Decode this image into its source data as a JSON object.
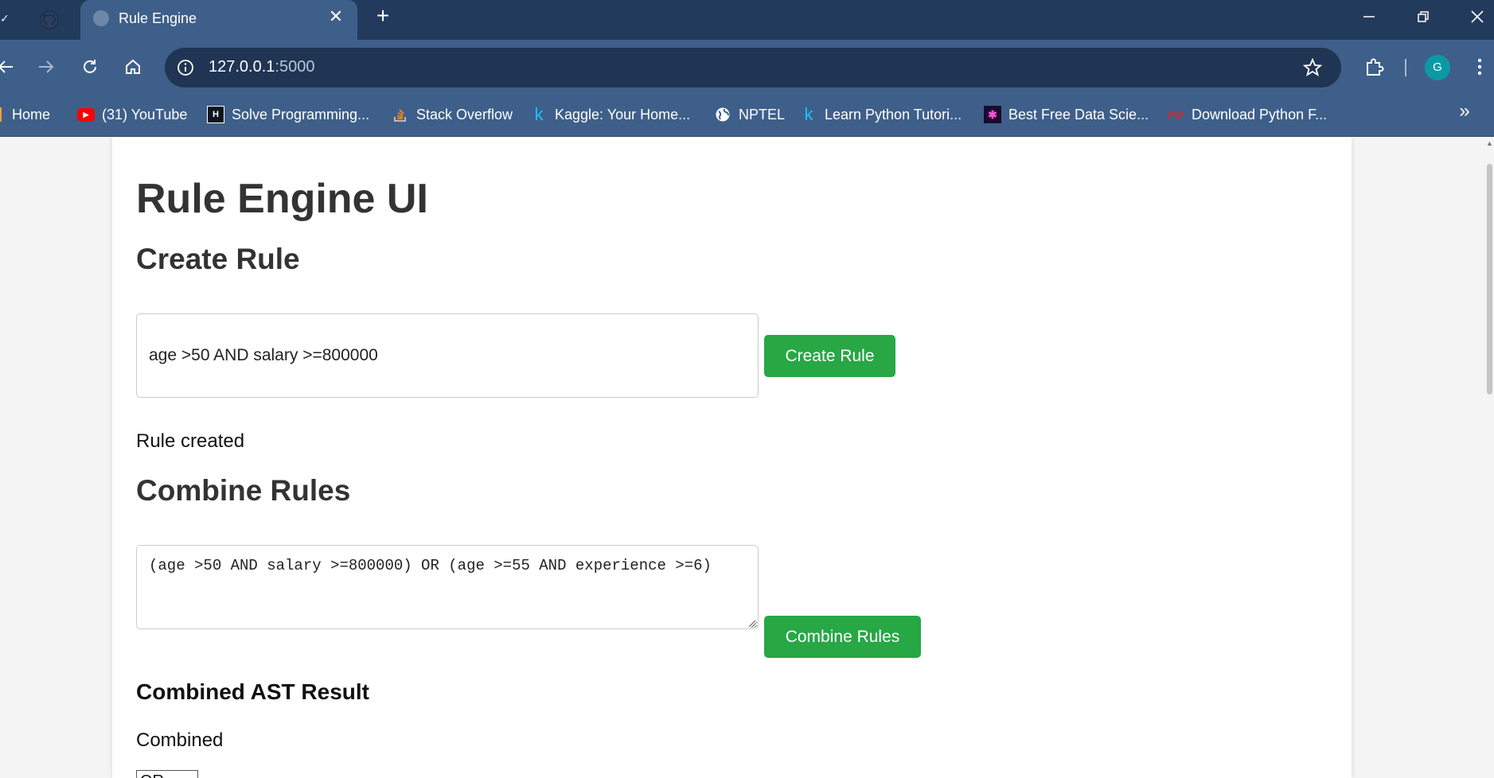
{
  "browser": {
    "tab_title": "Rule Engine",
    "url_host": "127.0.0.1",
    "url_port": ":5000",
    "profile_initial": "G",
    "bookmarks": [
      {
        "label": "Home",
        "icon": "bookmark-icon"
      },
      {
        "label": "(31) YouTube",
        "icon": "youtube-icon"
      },
      {
        "label": "Solve Programming...",
        "icon": "hackerrank-icon"
      },
      {
        "label": "Stack Overflow",
        "icon": "stackoverflow-icon"
      },
      {
        "label": "Kaggle: Your Home...",
        "icon": "kaggle-icon"
      },
      {
        "label": "NPTEL",
        "icon": "globe-icon"
      },
      {
        "label": "Learn Python Tutori...",
        "icon": "kaggle-icon"
      },
      {
        "label": "Best Free Data Scie...",
        "icon": "datascience-icon"
      },
      {
        "label": "Download Python F...",
        "icon": "pdf-icon"
      }
    ]
  },
  "page": {
    "title": "Rule Engine UI",
    "create": {
      "heading": "Create Rule",
      "input_value": "age >50 AND salary >=800000",
      "button_label": "Create Rule",
      "status": "Rule created"
    },
    "combine": {
      "heading": "Combine Rules",
      "textarea_value": "(age >50 AND salary >=800000) OR (age >=55 AND experience >=6)",
      "button_label": "Combine Rules"
    },
    "result": {
      "heading": "Combined AST Result",
      "status": "Combined",
      "node_label": "OR"
    }
  },
  "colors": {
    "button_green": "#28a745",
    "chrome_dark": "#223a5c",
    "chrome_toolbar": "#3e5f8a"
  }
}
